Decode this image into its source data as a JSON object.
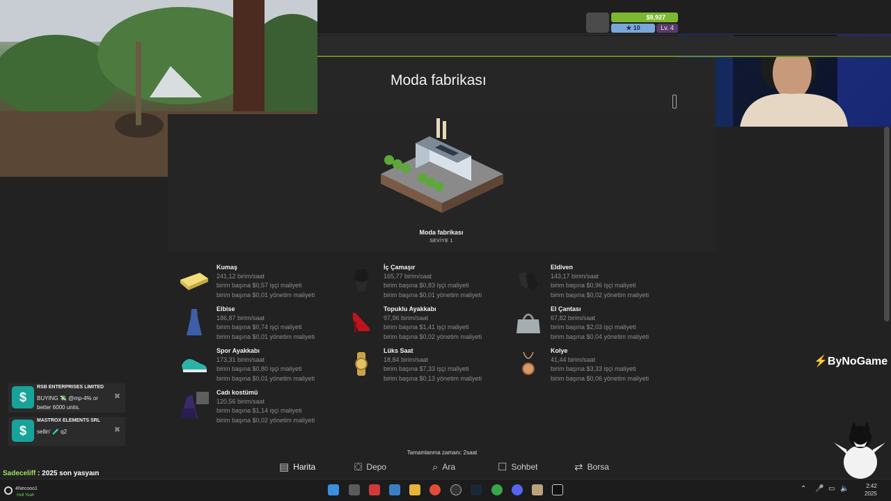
{
  "hud": {
    "money": "$9,927",
    "stars": "10",
    "level": "Lv. 4"
  },
  "page": {
    "title": "Moda fabrikası"
  },
  "building": {
    "name": "Moda fabrikası",
    "level": "SEVİYE 1"
  },
  "products": [
    {
      "name": "Kumaş",
      "rate": "241,12 birim/saat",
      "labor": "birim başına $0,57 işçi maliyeti",
      "admin": "birim başına $0,01 yönetim maliyeti",
      "icon": "fabric-icon"
    },
    {
      "name": "İç Çamaşır",
      "rate": "165,77 birim/saat",
      "labor": "birim başına $0,83 işçi maliyeti",
      "admin": "birim başına $0,01 yönetim maliyeti",
      "icon": "underwear-icon"
    },
    {
      "name": "Eldiven",
      "rate": "143,17 birim/saat",
      "labor": "birim başına $0,96 işçi maliyeti",
      "admin": "birim başına $0,02 yönetim maliyeti",
      "icon": "gloves-icon"
    },
    {
      "name": "Elbise",
      "rate": "186,87 birim/saat",
      "labor": "birim başına $0,74 işçi maliyeti",
      "admin": "birim başına $0,01 yönetim maliyeti",
      "icon": "dress-icon"
    },
    {
      "name": "Topuklu Ayakkabı",
      "rate": "97,96 birim/saat",
      "labor": "birim başına $1,41 işçi maliyeti",
      "admin": "birim başına $0,02 yönetim maliyeti",
      "icon": "high-heel-icon"
    },
    {
      "name": "El Çantası",
      "rate": "67,82 birim/saat",
      "labor": "birim başına $2,03 işçi maliyeti",
      "admin": "birim başına $0,04 yönetim maliyeti",
      "icon": "handbag-icon"
    },
    {
      "name": "Spor Ayakkabı",
      "rate": "173,31 birim/saat",
      "labor": "birim başına $0,80 işçi maliyeti",
      "admin": "birim başına $0,01 yönetim maliyeti",
      "icon": "sneaker-icon"
    },
    {
      "name": "Lüks Saat",
      "rate": "18,84 birim/saat",
      "labor": "birim başına $7,33 işçi maliyeti",
      "admin": "birim başına $0,13 yönetim maliyeti",
      "icon": "watch-icon"
    },
    {
      "name": "Kolye",
      "rate": "41,44 birim/saat",
      "labor": "birim başına $3,33 işçi maliyeti",
      "admin": "birim başına $0,06 yönetim maliyeti",
      "icon": "necklace-icon"
    },
    {
      "name": "Cadı kostümü",
      "rate": "120,56 birim/saat",
      "labor": "birim başına $1,14 işçi maliyeti",
      "admin": "birim başına $0,02 yönetim maliyeti",
      "icon": "witch-costume-icon"
    }
  ],
  "notifications": [
    {
      "title": "RSB ENTERPRISES LIMITED",
      "text": "BUYING 💸 @mp-4% or better 6000 units."
    },
    {
      "title": "MASTROX ELEMENTS SRL",
      "text": "sellin' 🧪 q2"
    }
  ],
  "completion": "Tamamlanma zamanı: 2saat",
  "nav": {
    "map": "Harita",
    "warehouse": "Depo",
    "search": "Ara",
    "chat": "Sohbet",
    "exchange": "Borsa"
  },
  "chat": {
    "user": "Sadeceliff",
    "message": " : 2025 son yasyaın"
  },
  "brand": "ByNoGame",
  "taskbar": {
    "user": "4Necooo1",
    "user_sub": "Hell Yeah",
    "time": "2:42",
    "year": "2025"
  },
  "colors": {
    "money": "#7cb82f",
    "accent_line": "#6c8a2a",
    "notif_icon": "#18a39a"
  }
}
